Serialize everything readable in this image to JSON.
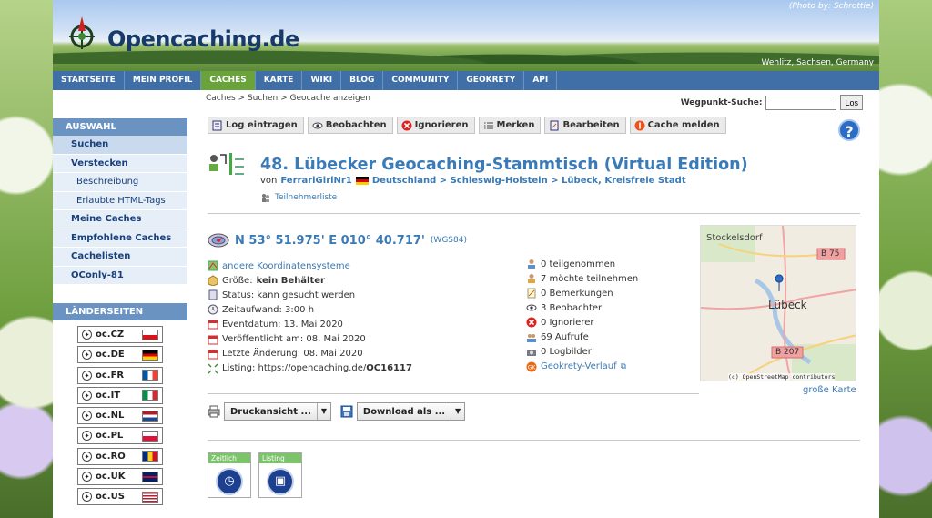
{
  "header": {
    "site_name": "Opencaching.de",
    "photo_credit": "(Photo by: Schrottie)",
    "location": "Wehlitz, Sachsen, Germany"
  },
  "nav": {
    "items": [
      "STARTSEITE",
      "MEIN PROFIL",
      "CACHES",
      "KARTE",
      "WIKI",
      "BLOG",
      "COMMUNITY",
      "GEOKRETY",
      "API"
    ],
    "active": "CACHES"
  },
  "breadcrumb": "Caches > Suchen > Geocache anzeigen",
  "waypoint_search": {
    "label": "Wegpunkt-Suche:",
    "value": "",
    "button": "Los"
  },
  "sidebar": {
    "section1_title": "AUSWAHL",
    "items": [
      "Suchen",
      "Verstecken",
      "Beschreibung",
      "Erlaubte HTML-Tags",
      "Meine Caches",
      "Empfohlene Caches",
      "Cachelisten",
      "OConly-81"
    ],
    "section2_title": "LÄNDERSEITEN",
    "countries": [
      "oc.CZ",
      "oc.DE",
      "oc.FR",
      "oc.IT",
      "oc.NL",
      "oc.PL",
      "oc.RO",
      "oc.UK",
      "oc.US"
    ]
  },
  "actions": [
    "Log eintragen",
    "Beobachten",
    "Ignorieren",
    "Merken",
    "Bearbeiten",
    "Cache melden"
  ],
  "cache": {
    "title": "48. Lübecker Geocaching-Stammtisch (Virtual Edition)",
    "by_prefix": "von",
    "owner": "FerrariGirlNr1",
    "region": "Deutschland > Schleswig-Holstein > Lübeck, Kreisfreie Stadt",
    "participants_link": "Teilnehmerliste"
  },
  "coords": {
    "value": "N 53° 51.975' E 010° 40.717'",
    "datum": "(WGS84)"
  },
  "details": {
    "other_coords": "andere Koordinatensysteme",
    "size_prefix": "Größe:",
    "size_value": "kein Behälter",
    "status": "Status: kann gesucht werden",
    "time": "Zeitaufwand: 3:00 h",
    "event_date": "Eventdatum: 13. Mai 2020",
    "published": "Veröffentlicht am: 08. Mai 2020",
    "last_change": "Letzte Änderung: 08. Mai 2020",
    "listing_prefix": "Listing: https://opencaching.de/",
    "listing_code": "OC16117"
  },
  "stats": {
    "attended": "0 teilgenommen",
    "will_attend": "7 möchte teilnehmen",
    "notes": "0 Bemerkungen",
    "watchers": "3 Beobachter",
    "ignorers": "0 Ignorierer",
    "views": "69 Aufrufe",
    "pictures": "0 Logbilder",
    "geokrety": "Geokrety-Verlauf"
  },
  "map": {
    "labels": [
      "Stockelsdorf",
      "Lübeck",
      "B 75",
      "B 207",
      "(c) OpenStreetMap contributors"
    ],
    "link": "große Karte"
  },
  "dropdowns": {
    "print": "Druckansicht ...",
    "download": "Download als ..."
  },
  "tiles": [
    {
      "label": "Zeitlich"
    },
    {
      "label": "Listing"
    }
  ],
  "colors": {
    "nav": "#3f6fa6",
    "nav_active": "#6aa23b",
    "link": "#3a7ab7",
    "sidebar_head": "#6a93c2"
  }
}
